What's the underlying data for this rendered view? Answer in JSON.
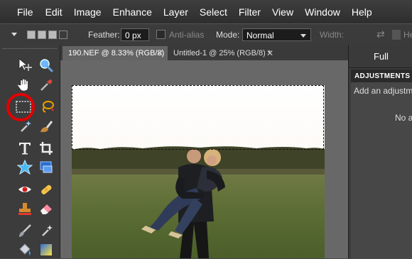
{
  "menu": [
    "File",
    "Edit",
    "Image",
    "Enhance",
    "Layer",
    "Select",
    "Filter",
    "View",
    "Window",
    "Help"
  ],
  "options": {
    "feather_label": "Feather:",
    "feather_value": "0 px",
    "antialias_label": "Anti-alias",
    "mode_label": "Mode:",
    "mode_value": "Normal",
    "width_label": "Width:",
    "height_label": "Heig"
  },
  "tabs": [
    {
      "label": "190.NEF @ 8.33% (RGB/8)",
      "active": true
    },
    {
      "label": "Untitled-1 @ 25% (RGB/8) *",
      "active": false
    }
  ],
  "panel": {
    "tab_label": "Full",
    "header": "ADJUSTMENTS",
    "hint": "Add an adjustm",
    "empty_text": "No a"
  },
  "tools": [
    "move-icon",
    "zoom-icon",
    "hand-icon",
    "eyedropper-icon",
    "rectangular-marquee-icon",
    "lasso-icon",
    "magic-wand-icon",
    "brush-selection-icon",
    "type-icon",
    "crop-icon",
    "shape-icon",
    "recompose-icon",
    "red-eye-icon",
    "healing-brush-icon",
    "clone-stamp-icon",
    "eraser-icon",
    "brush-icon",
    "smart-brush-icon",
    "paint-bucket-icon",
    "gradient-icon"
  ],
  "colors": {
    "highlight_circle": "#e30000",
    "workspace": "#686868",
    "panel_bg": "#3c3c3c"
  }
}
